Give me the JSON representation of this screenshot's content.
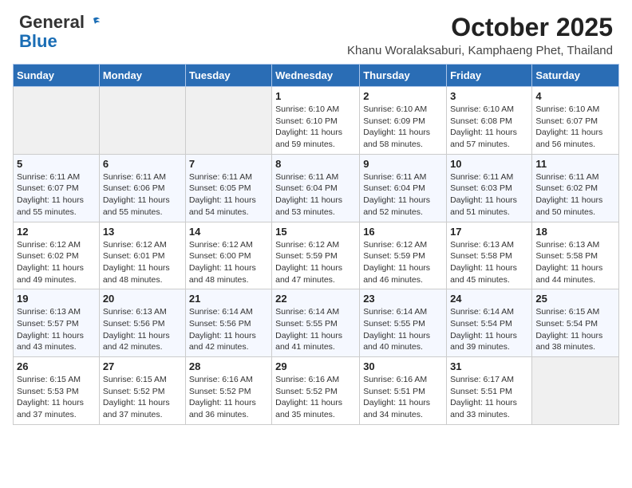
{
  "header": {
    "logo_general": "General",
    "logo_blue": "Blue",
    "title": "October 2025",
    "subtitle": "Khanu Woralaksaburi, Kamphaeng Phet, Thailand"
  },
  "days_of_week": [
    "Sunday",
    "Monday",
    "Tuesday",
    "Wednesday",
    "Thursday",
    "Friday",
    "Saturday"
  ],
  "weeks": [
    [
      {
        "day": "",
        "info": ""
      },
      {
        "day": "",
        "info": ""
      },
      {
        "day": "",
        "info": ""
      },
      {
        "day": "1",
        "info": "Sunrise: 6:10 AM\nSunset: 6:10 PM\nDaylight: 11 hours and 59 minutes."
      },
      {
        "day": "2",
        "info": "Sunrise: 6:10 AM\nSunset: 6:09 PM\nDaylight: 11 hours and 58 minutes."
      },
      {
        "day": "3",
        "info": "Sunrise: 6:10 AM\nSunset: 6:08 PM\nDaylight: 11 hours and 57 minutes."
      },
      {
        "day": "4",
        "info": "Sunrise: 6:10 AM\nSunset: 6:07 PM\nDaylight: 11 hours and 56 minutes."
      }
    ],
    [
      {
        "day": "5",
        "info": "Sunrise: 6:11 AM\nSunset: 6:07 PM\nDaylight: 11 hours and 55 minutes."
      },
      {
        "day": "6",
        "info": "Sunrise: 6:11 AM\nSunset: 6:06 PM\nDaylight: 11 hours and 55 minutes."
      },
      {
        "day": "7",
        "info": "Sunrise: 6:11 AM\nSunset: 6:05 PM\nDaylight: 11 hours and 54 minutes."
      },
      {
        "day": "8",
        "info": "Sunrise: 6:11 AM\nSunset: 6:04 PM\nDaylight: 11 hours and 53 minutes."
      },
      {
        "day": "9",
        "info": "Sunrise: 6:11 AM\nSunset: 6:04 PM\nDaylight: 11 hours and 52 minutes."
      },
      {
        "day": "10",
        "info": "Sunrise: 6:11 AM\nSunset: 6:03 PM\nDaylight: 11 hours and 51 minutes."
      },
      {
        "day": "11",
        "info": "Sunrise: 6:11 AM\nSunset: 6:02 PM\nDaylight: 11 hours and 50 minutes."
      }
    ],
    [
      {
        "day": "12",
        "info": "Sunrise: 6:12 AM\nSunset: 6:02 PM\nDaylight: 11 hours and 49 minutes."
      },
      {
        "day": "13",
        "info": "Sunrise: 6:12 AM\nSunset: 6:01 PM\nDaylight: 11 hours and 48 minutes."
      },
      {
        "day": "14",
        "info": "Sunrise: 6:12 AM\nSunset: 6:00 PM\nDaylight: 11 hours and 48 minutes."
      },
      {
        "day": "15",
        "info": "Sunrise: 6:12 AM\nSunset: 5:59 PM\nDaylight: 11 hours and 47 minutes."
      },
      {
        "day": "16",
        "info": "Sunrise: 6:12 AM\nSunset: 5:59 PM\nDaylight: 11 hours and 46 minutes."
      },
      {
        "day": "17",
        "info": "Sunrise: 6:13 AM\nSunset: 5:58 PM\nDaylight: 11 hours and 45 minutes."
      },
      {
        "day": "18",
        "info": "Sunrise: 6:13 AM\nSunset: 5:58 PM\nDaylight: 11 hours and 44 minutes."
      }
    ],
    [
      {
        "day": "19",
        "info": "Sunrise: 6:13 AM\nSunset: 5:57 PM\nDaylight: 11 hours and 43 minutes."
      },
      {
        "day": "20",
        "info": "Sunrise: 6:13 AM\nSunset: 5:56 PM\nDaylight: 11 hours and 42 minutes."
      },
      {
        "day": "21",
        "info": "Sunrise: 6:14 AM\nSunset: 5:56 PM\nDaylight: 11 hours and 42 minutes."
      },
      {
        "day": "22",
        "info": "Sunrise: 6:14 AM\nSunset: 5:55 PM\nDaylight: 11 hours and 41 minutes."
      },
      {
        "day": "23",
        "info": "Sunrise: 6:14 AM\nSunset: 5:55 PM\nDaylight: 11 hours and 40 minutes."
      },
      {
        "day": "24",
        "info": "Sunrise: 6:14 AM\nSunset: 5:54 PM\nDaylight: 11 hours and 39 minutes."
      },
      {
        "day": "25",
        "info": "Sunrise: 6:15 AM\nSunset: 5:54 PM\nDaylight: 11 hours and 38 minutes."
      }
    ],
    [
      {
        "day": "26",
        "info": "Sunrise: 6:15 AM\nSunset: 5:53 PM\nDaylight: 11 hours and 37 minutes."
      },
      {
        "day": "27",
        "info": "Sunrise: 6:15 AM\nSunset: 5:52 PM\nDaylight: 11 hours and 37 minutes."
      },
      {
        "day": "28",
        "info": "Sunrise: 6:16 AM\nSunset: 5:52 PM\nDaylight: 11 hours and 36 minutes."
      },
      {
        "day": "29",
        "info": "Sunrise: 6:16 AM\nSunset: 5:52 PM\nDaylight: 11 hours and 35 minutes."
      },
      {
        "day": "30",
        "info": "Sunrise: 6:16 AM\nSunset: 5:51 PM\nDaylight: 11 hours and 34 minutes."
      },
      {
        "day": "31",
        "info": "Sunrise: 6:17 AM\nSunset: 5:51 PM\nDaylight: 11 hours and 33 minutes."
      },
      {
        "day": "",
        "info": ""
      }
    ]
  ]
}
